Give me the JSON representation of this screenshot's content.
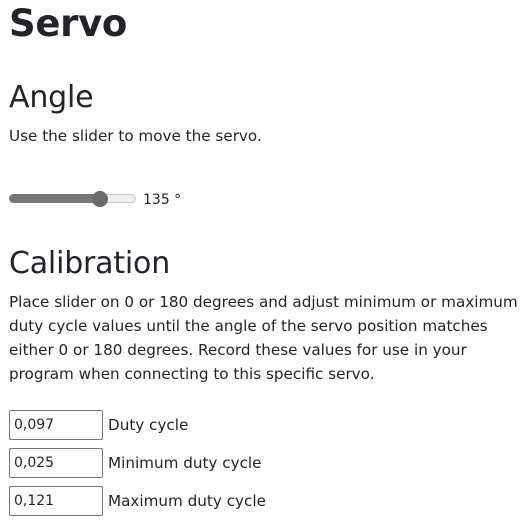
{
  "page": {
    "title": "Servo"
  },
  "angle": {
    "heading": "Angle",
    "description": "Use the slider to move the servo.",
    "slider": {
      "value": 135,
      "min": 0,
      "max": 180,
      "value_label": "135 °"
    }
  },
  "calibration": {
    "heading": "Calibration",
    "description": "Place slider on 0 or 180 degrees and adjust minimum or maximum duty cycle values until the angle of the servo position matches either 0 or 180 degrees. Record these values for use in your program when connecting to this specific servo.",
    "fields": [
      {
        "value": "0,097",
        "label": "Duty cycle"
      },
      {
        "value": "0,025",
        "label": "Minimum duty cycle"
      },
      {
        "value": "0,121",
        "label": "Maximum duty cycle"
      }
    ]
  }
}
